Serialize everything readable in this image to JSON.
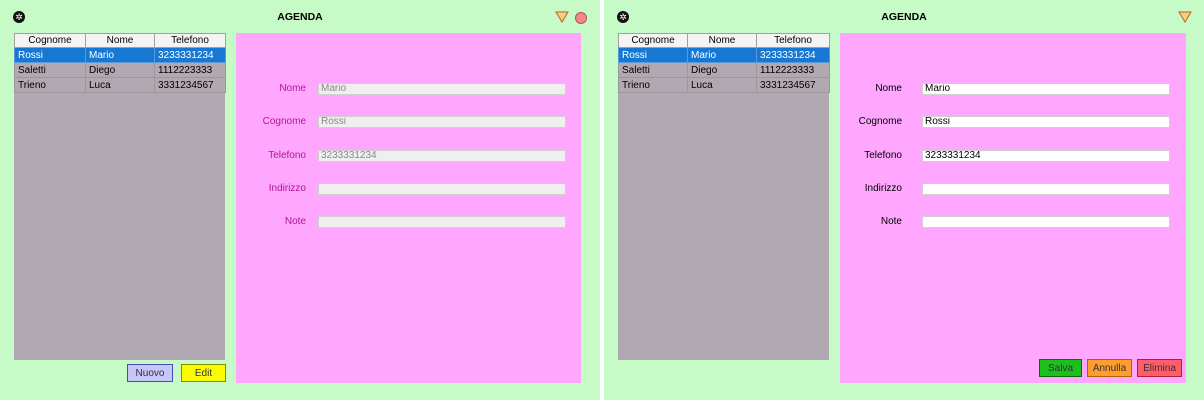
{
  "left_window": {
    "title": "AGENDA",
    "table": {
      "headers": [
        "Cognome",
        "Nome",
        "Telefono"
      ],
      "rows": [
        [
          "Rossi",
          "Mario",
          "3233331234"
        ],
        [
          "Saletti",
          "Diego",
          "1112223333"
        ],
        [
          "Trieno",
          "Luca",
          "3331234567"
        ]
      ]
    },
    "form": {
      "labels": [
        "Nome",
        "Cognome",
        "Telefono",
        "Indirizzo",
        "Note"
      ],
      "values": [
        "Mario",
        "Rossi",
        "3233331234",
        "",
        ""
      ]
    },
    "buttons": {
      "nuovo": "Nuovo",
      "edit": "Edit"
    }
  },
  "right_window": {
    "title": "AGENDA",
    "table": {
      "headers": [
        "Cognome",
        "Nome",
        "Telefono"
      ],
      "rows": [
        [
          "Rossi",
          "Mario",
          "3233331234"
        ],
        [
          "Saletti",
          "Diego",
          "1112223333"
        ],
        [
          "Trieno",
          "Luca",
          "3331234567"
        ]
      ]
    },
    "form": {
      "labels": [
        "Nome",
        "Cognome",
        "Telefono",
        "Indirizzo",
        "Note"
      ],
      "values": [
        "Mario",
        "Rossi",
        "3233331234",
        "",
        ""
      ]
    },
    "buttons": {
      "salva": "Salva",
      "annulla": "Annulla",
      "elimina": "Elimina"
    }
  },
  "icons": {
    "gear": "gear-icon",
    "triangle": "triangle-down-icon",
    "close": "close-icon"
  },
  "colors": {
    "background": "#c6fac6",
    "form_panel": "#ffa6fe",
    "table_panel": "#b2a8b1",
    "selected_row": "#1678d2",
    "label_view_mode": "#b0169a",
    "nuovo": "#c6c6fa",
    "edit": "#fafa00",
    "salva": "#1cc01c",
    "annulla": "#ff9c30",
    "elimina": "#ff5d6a"
  }
}
